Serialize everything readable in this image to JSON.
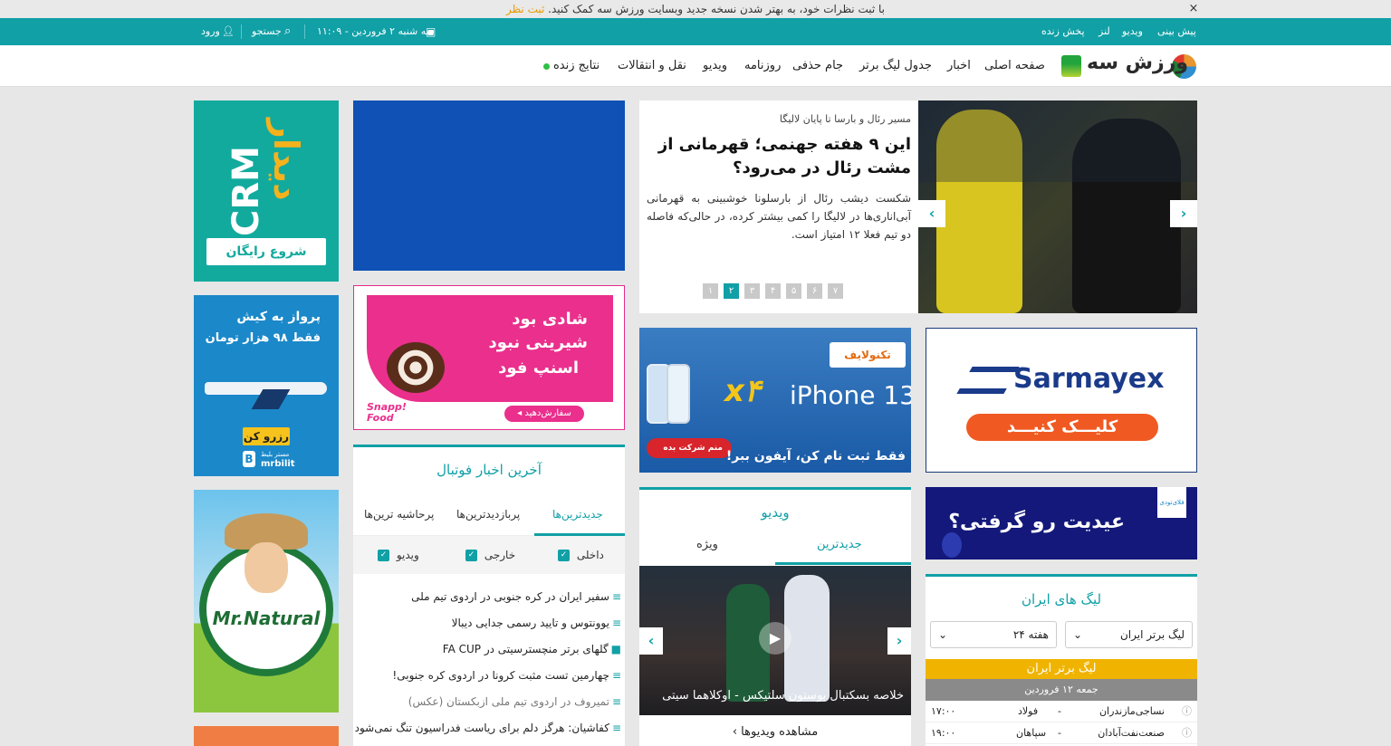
{
  "notice": {
    "text": "با ثبت نظرات خود، به بهتر شدن نسخه جدید وبسایت ورزش سه کمک کنید.",
    "link": "ثبت نظر",
    "close": "×"
  },
  "topbar": {
    "links": [
      "پیش بینی",
      "ویدیو",
      "لنز",
      "پخش زنده"
    ],
    "date": "سه شنبه ۲ فروردین - ۱۱:۰۹",
    "search": "جستجو",
    "login": "ورود"
  },
  "nav": {
    "logo": "ورزش سه",
    "items": [
      "صفحه اصلی",
      "اخبار",
      "جدول لیگ برتر",
      "جام حذفی",
      "روزنامه",
      "ویدیو",
      "نقل و انتقالات",
      "نتایج زنده"
    ]
  },
  "hero": {
    "kicker": "مسیر رئال و بارسا تا پایان لالیگا",
    "title": "این ۹ هفته جهنمی؛ قهرمانی از مشت رئال در می‌رود؟",
    "desc": "شکست دیشب رئال از بارسلونا خوشبینی به قهرمانی آبی‌اناری‌ها در لالیگا را کمی بیشتر کرده، در حالی‌که فاصله دو تیم فعلا ۱۲ امتیاز است.",
    "pages": [
      "۷",
      "۶",
      "۵",
      "۴",
      "۳",
      "۲",
      "۱"
    ],
    "active_page": "۲"
  },
  "ads": {
    "crm_word": "CRM",
    "crm_title": "دیدار",
    "crm_btn": "شروع رایگان",
    "kish_line1": "پرواز به کیش",
    "kish_line2": "فقط ۹۸ هزار تومان",
    "kish_btn": "رزرو کن",
    "kish_brand": "mrbilit",
    "kish_brand_sub": "مستر بلیط",
    "natural": "Mr.Natural",
    "snapp_line1": "شادی بود",
    "snapp_line2": "شیرینی نبود",
    "snapp_line3": "اسنپ فود",
    "snapp_btn": "سفارش‌دهید ◂",
    "snapp_brand": "Snapp! Food",
    "iphone_brand": "تکنولایف",
    "iphone_model": "iPhone 13",
    "iphone_x4": "x۴",
    "iphone_btn": "منم شرکت بده",
    "iphone_slogan": "فقط ثبت نام کن، آیفون ببر!",
    "sarmayex_name": "Sarmayex",
    "sarmayex_btn": "کلیـــک کنیـــد",
    "eid_text": "عیدیت رو گرفتی؟",
    "eid_brand": "فلای‌تودی"
  },
  "football_news": {
    "title": "آخرین اخبار فوتبال",
    "tabs": [
      "جدیدترین‌ها",
      "پربازدیدترین‌ها",
      "پرحاشیه ترین‌ها"
    ],
    "filters": [
      "داخلی",
      "خارجی",
      "ویدیو"
    ],
    "items": [
      "سفیر ایران در کره جنوبی در اردوی تیم ملی",
      "یوونتوس و تایید رسمی جدایی دیبالا",
      "گلهای برتر منچسترسیتی در FA CUP",
      "چهارمین تست مثبت کرونا در اردوی کره جنوبی!",
      "تمیروف در اردوی تیم ملی ازبکستان (عکس)",
      "کفاشیان: هرگز دلم برای ریاست فدراسیون تنگ نمی‌شود"
    ]
  },
  "video": {
    "title": "ویدیو",
    "tabs": [
      "جدیدترین",
      "ویژه"
    ],
    "caption": "خلاصه بسکتبال بوستون سلتیکس - اوکلاهما سیتی",
    "more": "مشاهده ویدیوها"
  },
  "leagues": {
    "title": "لیگ های ایران",
    "select_league": "لیگ برتر ایران",
    "select_week": "هفته ۲۴",
    "banner": "لیگ برتر ایران",
    "date": "جمعه ۱۲ فروردین",
    "matches": [
      {
        "home": "نساجی‌مازندران",
        "away": "فولاد",
        "sep": "-",
        "time": "۱۷:۰۰"
      },
      {
        "home": "صنعت‌نفت‌آبادان",
        "away": "سپاهان",
        "sep": "-",
        "time": "۱۹:۰۰"
      }
    ]
  },
  "colors": {
    "accent": "#10a0a6",
    "notice_link": "#e79a00",
    "banner": "#f0b400"
  }
}
